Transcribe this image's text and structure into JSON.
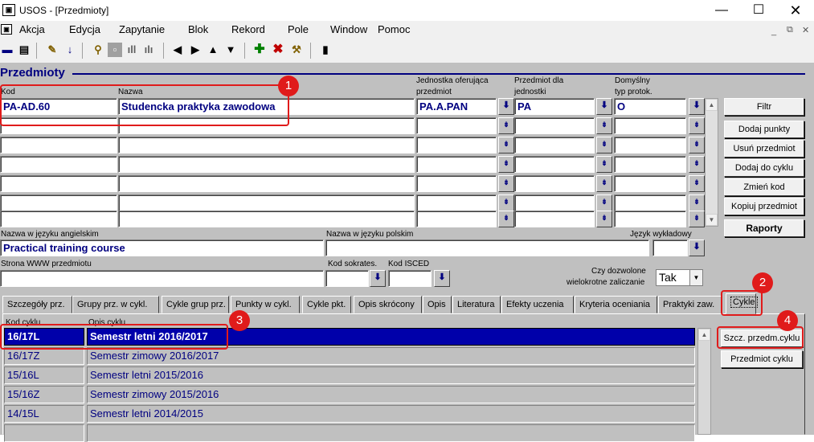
{
  "window": {
    "title": "USOS - [Przedmioty]"
  },
  "menu": [
    "Akcja",
    "Edycja",
    "Zapytanie",
    "Blok",
    "Rekord",
    "Pole",
    "Window",
    "Pomoc"
  ],
  "form": {
    "title": "Przedmioty",
    "headers": {
      "kod": "Kod",
      "nazwa": "Nazwa",
      "jednostka": [
        "Jednostka oferująca",
        "przedmiot"
      ],
      "przedmiot_dla": [
        "Przedmiot dla",
        "jednostki"
      ],
      "typ": [
        "Domyślny",
        "typ protok."
      ]
    },
    "record": {
      "kod": "PA-AD.60",
      "nazwa": "Studencka praktyka zawodowa",
      "jednostka": "PA.A.PAN",
      "przedmiot_dla": "PA",
      "typ": "O"
    },
    "nazwa_ang_label": "Nazwa w języku angielskim",
    "nazwa_ang": "Practical training course",
    "nazwa_pol_label": "Nazwa w języku polskim",
    "jezyk_label": "Język wykładowy",
    "www_label": "Strona WWW  przedmiotu",
    "sokrates_label": "Kod sokrates.",
    "isced_label": "Kod ISCED",
    "wielokrotne_label": [
      "Czy dozwolone",
      "wielokrotne zaliczanie"
    ],
    "wielokrotne_value": "Tak"
  },
  "buttons": {
    "filtr": "Filtr",
    "dodaj_punkty": "Dodaj punkty",
    "usun": "Usuń przedmiot",
    "dodaj_cykl": "Dodaj do cyklu",
    "zmien_kod": "Zmień kod",
    "kopiuj": "Kopiuj przedmiot",
    "raporty": "Raporty",
    "szcz_cyklu": "Szcz. przedm.cyklu",
    "przedmiot_cyklu": "Przedmiot cyklu"
  },
  "tabs": [
    "Szczegóły prz.",
    "Grupy prz. w cykl.",
    "Cykle grup prz.",
    "Punkty w cykl.",
    "Cykle pkt.",
    "Opis skrócony",
    "Opis",
    "Literatura",
    "Efekty uczenia",
    "Kryteria oceniania",
    "Praktyki zaw.",
    "Cykle"
  ],
  "cycles": {
    "col_kod": "Kod cyklu",
    "col_opis": "Opis cyklu",
    "rows": [
      {
        "kod": "16/17L",
        "opis": "Semestr letni 2016/2017"
      },
      {
        "kod": "16/17Z",
        "opis": "Semestr zimowy 2016/2017"
      },
      {
        "kod": "15/16L",
        "opis": "Semestr letni 2015/2016"
      },
      {
        "kod": "15/16Z",
        "opis": "Semestr zimowy 2015/2016"
      },
      {
        "kod": "14/15L",
        "opis": "Semestr letni 2014/2015"
      },
      {
        "kod": "",
        "opis": ""
      }
    ]
  },
  "annotations": [
    "1",
    "2",
    "3",
    "4"
  ],
  "colors": {
    "accent": "#000080",
    "selection": "#0000aa",
    "annotation": "#e01b1b"
  }
}
